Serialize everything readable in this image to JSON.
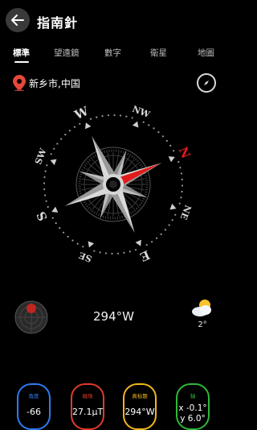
{
  "header": {
    "title": "指南針"
  },
  "tabs": [
    {
      "label": "標準",
      "active": true
    },
    {
      "label": "望遠鏡",
      "active": false
    },
    {
      "label": "數字",
      "active": false
    },
    {
      "label": "衛星",
      "active": false
    },
    {
      "label": "地圖",
      "active": false
    }
  ],
  "location": {
    "text": "新乡市,中国",
    "icon": "location-pin-icon"
  },
  "compass": {
    "cardinals": {
      "n": "N",
      "ne": "NE",
      "e": "E",
      "se": "SE",
      "s": "S",
      "sw": "SW",
      "w": "W",
      "nw": "NW"
    },
    "needle_color": "#e21b1b"
  },
  "bearing": {
    "text": "294°W"
  },
  "weather": {
    "icon": "partly-cloudy-icon",
    "temp": "2°"
  },
  "cards": [
    {
      "label": "角度",
      "value": "-66",
      "color": "#2f7bf2"
    },
    {
      "label": "磁场",
      "value": "27.1μT",
      "color": "#e23a2a"
    },
    {
      "label": "真标题",
      "value": "294°W",
      "color": "#f2b71c"
    },
    {
      "label": "轴",
      "value_line1": "x -0.1°",
      "value_line2": "y 6.0°",
      "color": "#2fb83a"
    }
  ]
}
